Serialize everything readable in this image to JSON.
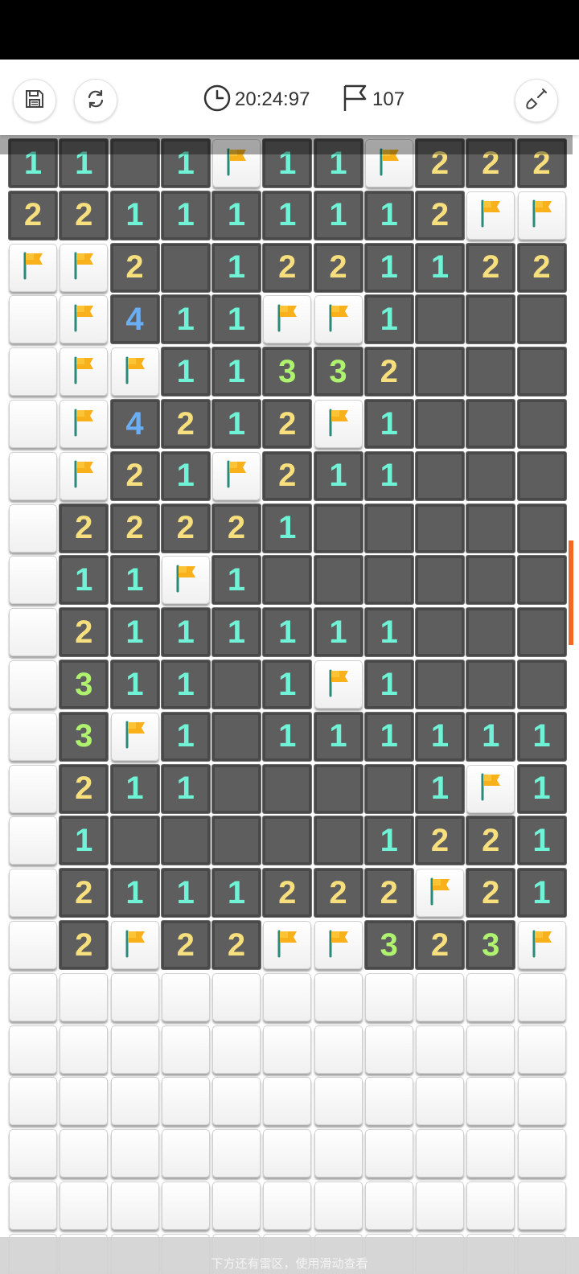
{
  "header": {
    "timer": "20:24:97",
    "flag_count": "107",
    "icons": {
      "save": "save-disk-icon",
      "restart": "restart-arrows-icon",
      "timer": "clock-icon",
      "flags": "flag-outline-icon",
      "tool": "shovel-icon"
    }
  },
  "board": {
    "columns": 11,
    "legend": "digits = adjacent mine count; F = flagged cell; H = hidden cell; 0 = revealed empty",
    "rows": [
      "11 1F11F222",
      "22111111FF",
      "FF2 122112 2",
      "HF411FF1",
      "HFF11332",
      "HF4212F1",
      "HF21F211",
      "H22221",
      "H11F1",
      "H2111111",
      "H311 1F1",
      "H3F1 111111",
      "H211    1F1",
      "H1     1221",
      "H2111222F21",
      "H2F22FF323F",
      "HHHHHHHHHHH",
      "HHHHHHHHHHH",
      "HHHHHHHHHHH",
      "HHHHHHHHHHH",
      "HHHHHHHHHHH",
      "HHHHHHHHHHH"
    ],
    "grid": [
      [
        "1",
        "1",
        "0",
        "1",
        "F",
        "1",
        "1",
        "F",
        "2",
        "2",
        "2"
      ],
      [
        "2",
        "2",
        "1",
        "1",
        "1",
        "1",
        "1",
        "1",
        "2",
        "F",
        "F"
      ],
      [
        "F",
        "F",
        "2",
        "0",
        "1",
        "2",
        "2",
        "1",
        "1",
        "2",
        "2"
      ],
      [
        "H",
        "F",
        "4",
        "1",
        "1",
        "F",
        "F",
        "1",
        "0",
        "0",
        "0"
      ],
      [
        "H",
        "F",
        "F",
        "1",
        "1",
        "3",
        "3",
        "2",
        "0",
        "0",
        "0"
      ],
      [
        "H",
        "F",
        "4",
        "2",
        "1",
        "2",
        "F",
        "1",
        "0",
        "0",
        "0"
      ],
      [
        "H",
        "F",
        "2",
        "1",
        "F",
        "2",
        "1",
        "1",
        "0",
        "0",
        "0"
      ],
      [
        "H",
        "2",
        "2",
        "2",
        "2",
        "1",
        "0",
        "0",
        "0",
        "0",
        "0"
      ],
      [
        "H",
        "1",
        "1",
        "F",
        "1",
        "0",
        "0",
        "0",
        "0",
        "0",
        "0"
      ],
      [
        "H",
        "2",
        "1",
        "1",
        "1",
        "1",
        "1",
        "1",
        "0",
        "0",
        "0"
      ],
      [
        "H",
        "3",
        "1",
        "1",
        "0",
        "1",
        "F",
        "1",
        "0",
        "0",
        "0"
      ],
      [
        "H",
        "3",
        "F",
        "1",
        "0",
        "1",
        "1",
        "1",
        "1",
        "1",
        "1"
      ],
      [
        "H",
        "2",
        "1",
        "1",
        "0",
        "0",
        "0",
        "0",
        "1",
        "F",
        "1"
      ],
      [
        "H",
        "1",
        "0",
        "0",
        "0",
        "0",
        "0",
        "1",
        "2",
        "2",
        "1"
      ],
      [
        "H",
        "2",
        "1",
        "1",
        "1",
        "2",
        "2",
        "2",
        "F",
        "2",
        "1"
      ],
      [
        "H",
        "2",
        "F",
        "2",
        "2",
        "F",
        "F",
        "3",
        "2",
        "3",
        "F"
      ],
      [
        "H",
        "H",
        "H",
        "H",
        "H",
        "H",
        "H",
        "H",
        "H",
        "H",
        "H"
      ],
      [
        "H",
        "H",
        "H",
        "H",
        "H",
        "H",
        "H",
        "H",
        "H",
        "H",
        "H"
      ],
      [
        "H",
        "H",
        "H",
        "H",
        "H",
        "H",
        "H",
        "H",
        "H",
        "H",
        "H"
      ],
      [
        "H",
        "H",
        "H",
        "H",
        "H",
        "H",
        "H",
        "H",
        "H",
        "H",
        "H"
      ],
      [
        "H",
        "H",
        "H",
        "H",
        "H",
        "H",
        "H",
        "H",
        "H",
        "H",
        "H"
      ],
      [
        "H",
        "H",
        "H",
        "H",
        "H",
        "H",
        "H",
        "H",
        "H",
        "H",
        "H"
      ]
    ]
  },
  "colors": {
    "num_1": "#6ff2d6",
    "num_2": "#f7df7d",
    "num_3": "#aef26f",
    "num_4": "#6aaef5",
    "flag": "#f9b11b",
    "scroll_indicator": "#f26a21"
  },
  "hint": "下方还有雷区，使用滑动查看"
}
